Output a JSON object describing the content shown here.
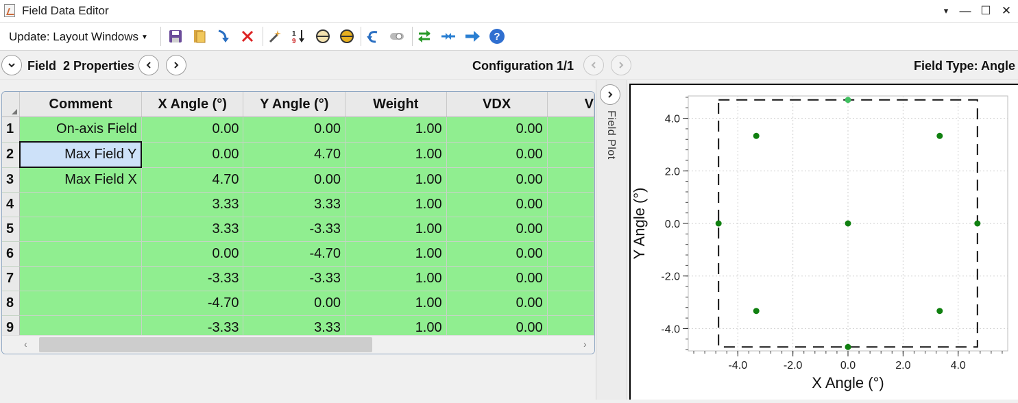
{
  "window": {
    "title": "Field Data Editor",
    "controls": [
      "▾",
      "—",
      "☐",
      "✕"
    ]
  },
  "toolbar": {
    "update_label": "Update: Layout Windows",
    "icons": [
      "save-icon",
      "open-icon",
      "insert-icon",
      "delete-icon",
      "wizard-icon",
      "sort-icon",
      "ellipse-icon",
      "ellipse-filled-icon",
      "undo-icon",
      "toggle-icon",
      "swap-icon",
      "arrows-icon",
      "arrow-right-icon",
      "help-icon"
    ]
  },
  "properties": {
    "title": "Field  2 Properties",
    "configuration": "Configuration 1/1",
    "field_type": "Field Type: Angle"
  },
  "table": {
    "headers": [
      "Comment",
      "X Angle (°)",
      "Y Angle (°)",
      "Weight",
      "VDX",
      "V"
    ],
    "rows": [
      {
        "n": "1",
        "comment": "On-axis Field",
        "x": "0.00",
        "y": "0.00",
        "w": "1.00",
        "vdx": "0.00"
      },
      {
        "n": "2",
        "comment": "Max Field Y",
        "x": "0.00",
        "y": "4.70",
        "w": "1.00",
        "vdx": "0.00"
      },
      {
        "n": "3",
        "comment": "Max Field X",
        "x": "4.70",
        "y": "0.00",
        "w": "1.00",
        "vdx": "0.00"
      },
      {
        "n": "4",
        "comment": "",
        "x": "3.33",
        "y": "3.33",
        "w": "1.00",
        "vdx": "0.00"
      },
      {
        "n": "5",
        "comment": "",
        "x": "3.33",
        "y": "-3.33",
        "w": "1.00",
        "vdx": "0.00"
      },
      {
        "n": "6",
        "comment": "",
        "x": "0.00",
        "y": "-4.70",
        "w": "1.00",
        "vdx": "0.00"
      },
      {
        "n": "7",
        "comment": "",
        "x": "-3.33",
        "y": "-3.33",
        "w": "1.00",
        "vdx": "0.00"
      },
      {
        "n": "8",
        "comment": "",
        "x": "-4.70",
        "y": "0.00",
        "w": "1.00",
        "vdx": "0.00"
      },
      {
        "n": "9",
        "comment": "",
        "x": "-3.33",
        "y": "3.33",
        "w": "1.00",
        "vdx": "0.00"
      }
    ],
    "selected_row": 2
  },
  "plot_tab_label": "Field Plot",
  "chart_data": {
    "type": "scatter",
    "xlabel": "X Angle (°)",
    "ylabel": "Y Angle (°)",
    "xlim": [
      -5.8,
      5.8
    ],
    "ylim": [
      -4.85,
      4.85
    ],
    "xticks": [
      -4.0,
      -2.0,
      0.0,
      2.0,
      4.0
    ],
    "yticks": [
      -4.0,
      -2.0,
      0.0,
      2.0,
      4.0
    ],
    "xtick_labels": [
      "-4.0",
      "-2.0",
      "0.0",
      "2.0",
      "4.0"
    ],
    "ytick_labels": [
      "-4.0",
      "-2.0",
      "0.0",
      "2.0",
      "4.0"
    ],
    "grid": true,
    "boundary": {
      "style": "dashed",
      "x": [
        -4.7,
        4.7
      ],
      "y": [
        -4.7,
        4.7
      ]
    },
    "point_color": "#108010",
    "selected_color": "#40c060",
    "selected_index": 1,
    "x": [
      0.0,
      0.0,
      4.7,
      3.33,
      3.33,
      0.0,
      -3.33,
      -4.7,
      -3.33
    ],
    "y": [
      0.0,
      4.7,
      0.0,
      3.33,
      -3.33,
      -4.7,
      -3.33,
      0.0,
      3.33
    ]
  }
}
